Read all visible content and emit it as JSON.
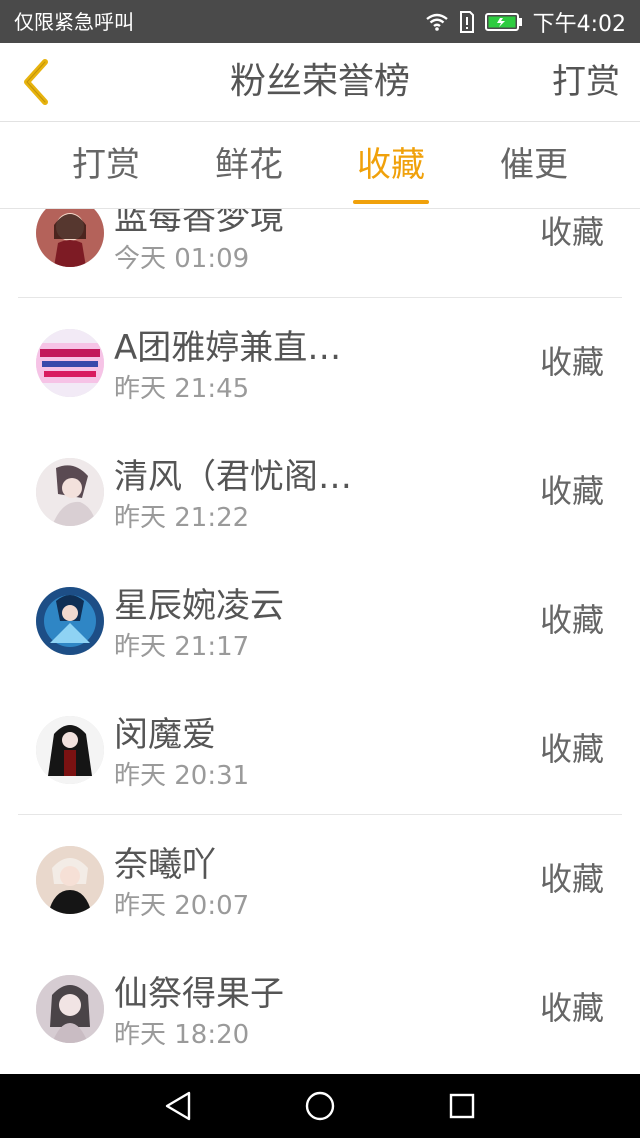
{
  "status_bar": {
    "carrier_text": "仅限紧急呼叫",
    "time": "下午4:02",
    "icons": [
      "wifi-icon",
      "sim-alert-icon",
      "battery-icon"
    ],
    "battery_color": "#2ecc40"
  },
  "header": {
    "back_icon": "chevron-left-icon",
    "title": "粉丝荣誉榜",
    "action_label": "打赏",
    "accent_color": "#f0a10b"
  },
  "tabs": [
    {
      "label": "打赏",
      "active": false
    },
    {
      "label": "鲜花",
      "active": false
    },
    {
      "label": "收藏",
      "active": true
    },
    {
      "label": "催更",
      "active": false
    }
  ],
  "list": {
    "items": [
      {
        "name": "蓝莓香梦境",
        "time": "今天 01:09",
        "action": "收藏"
      },
      {
        "name": "A团雅婷兼直…",
        "time": "昨天 21:45",
        "action": "收藏"
      },
      {
        "name": "清风（君忧阁…",
        "time": "昨天 21:22",
        "action": "收藏"
      },
      {
        "name": "星辰婉凌云",
        "time": "昨天 21:17",
        "action": "收藏"
      },
      {
        "name": "闵魔爱",
        "time": "昨天 20:31",
        "action": "收藏"
      },
      {
        "name": "奈曦吖",
        "time": "昨天 20:07",
        "action": "收藏"
      },
      {
        "name": "仙祭得果子",
        "time": "昨天 18:20",
        "action": "收藏"
      }
    ]
  },
  "nav_bar": {
    "icons": [
      "back-triangle-icon",
      "home-circle-icon",
      "recents-square-icon"
    ]
  }
}
